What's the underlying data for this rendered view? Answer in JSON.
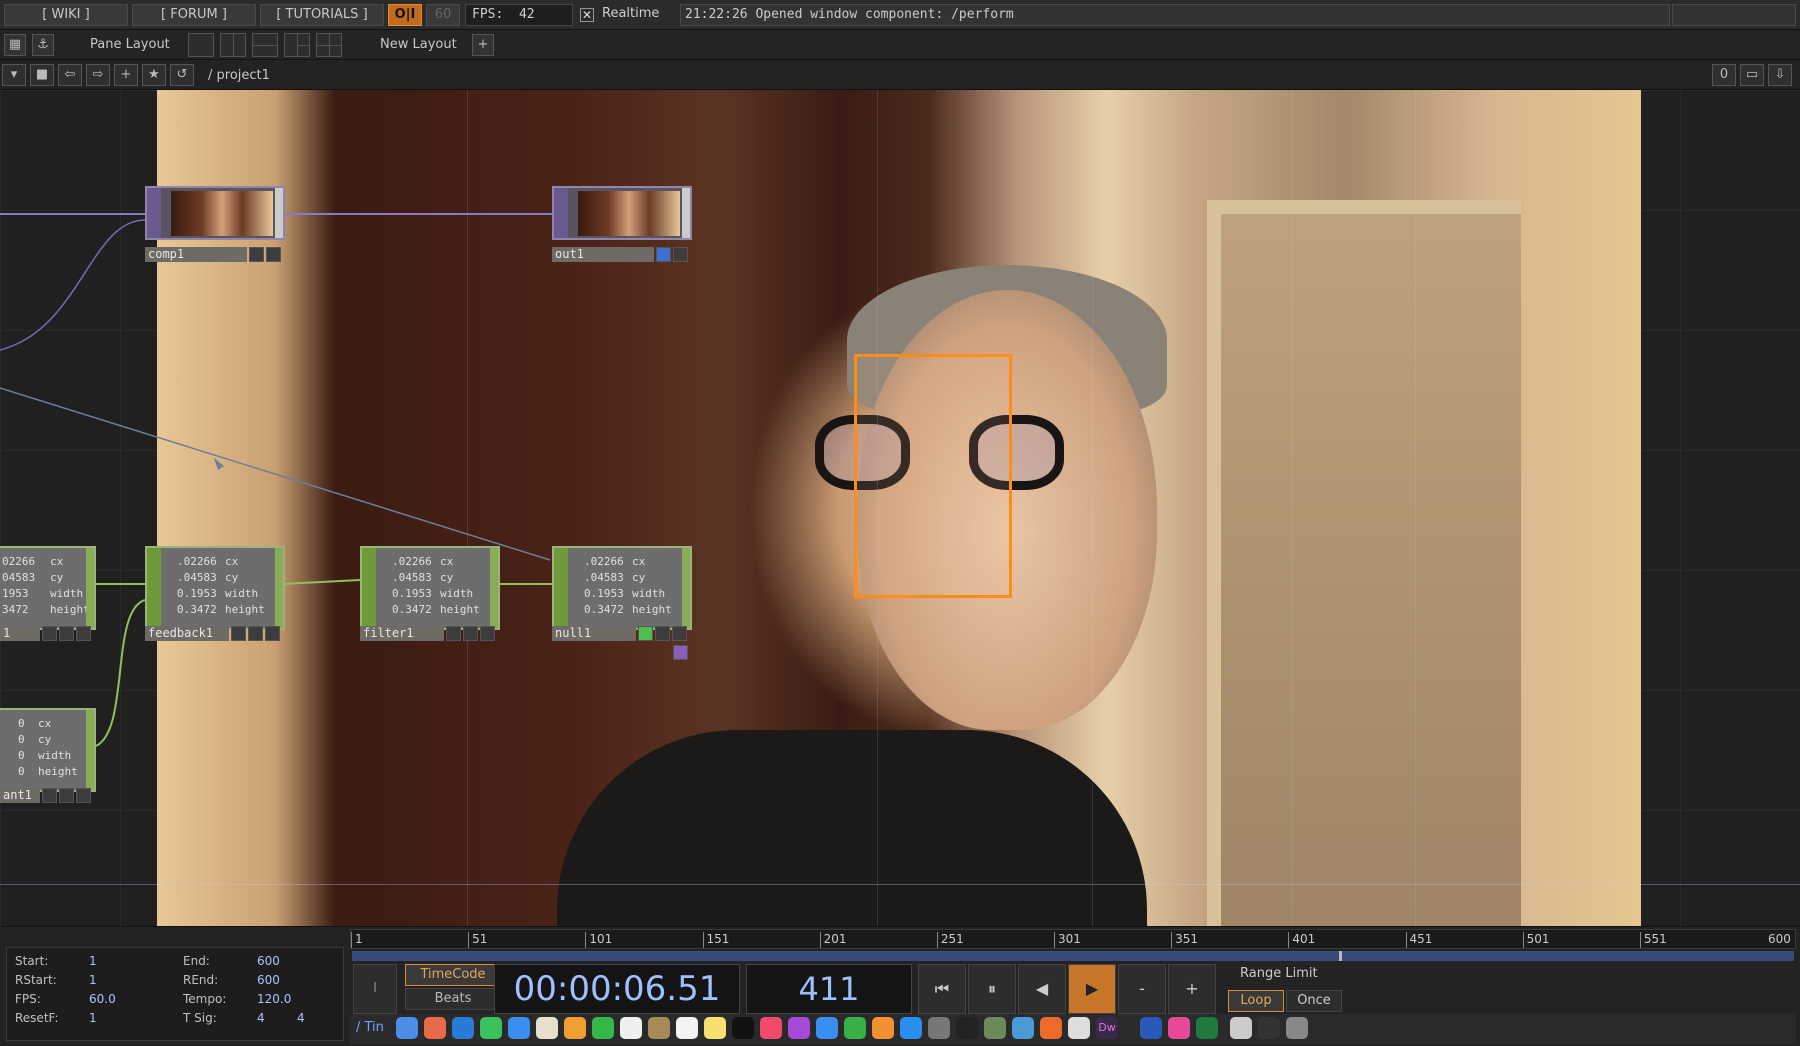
{
  "topbar": {
    "wiki": "[ WIKI ]",
    "forum": "[ FORUM ]",
    "tutorials": "[ TUTORIALS ]",
    "oi": "O|I",
    "sixty": "60",
    "fps_label": "FPS:",
    "fps_value": "42",
    "realtime_checked": "✕",
    "realtime_label": "Realtime",
    "message": "21:22:26 Opened window component: /perform"
  },
  "layoutbar": {
    "pane_layout": "Pane Layout",
    "new_layout": "New Layout",
    "add": "+"
  },
  "pathbar": {
    "path": "/ project1",
    "counter": "0"
  },
  "nodes": {
    "comp1": "comp1",
    "out1": "out1",
    "feedback1": "feedback1",
    "filter1": "filter1",
    "null1": "null1",
    "left_label1": "1",
    "constant_label": "ant1"
  },
  "chop_rows": [
    {
      "value": ".02266",
      "name": "cx"
    },
    {
      "value": ".04583",
      "name": "cy"
    },
    {
      "value": "0.1953",
      "name": "width"
    },
    {
      "value": "0.3472",
      "name": "height"
    }
  ],
  "left_chop_rows": [
    {
      "value": "02266",
      "name": "cx"
    },
    {
      "value": "04583",
      "name": "cy"
    },
    {
      "value": "1953",
      "name": "width"
    },
    {
      "value": "3472",
      "name": "height"
    }
  ],
  "const_rows": [
    {
      "value": "0",
      "name": "cx"
    },
    {
      "value": "0",
      "name": "cy"
    },
    {
      "value": "0",
      "name": "width"
    },
    {
      "value": "0",
      "name": "height"
    }
  ],
  "timeline": {
    "ticks": [
      "1",
      "51",
      "101",
      "151",
      "201",
      "251",
      "301",
      "351",
      "401",
      "451",
      "501",
      "551",
      "600"
    ],
    "current_frame_fraction": 0.6817
  },
  "info": {
    "start_label": "Start:",
    "start": "1",
    "end_label": "End:",
    "end": "600",
    "rstart_label": "RStart:",
    "rstart": "1",
    "rend_label": "REnd:",
    "rend": "600",
    "fps_label": "FPS:",
    "fps": "60.0",
    "tempo_label": "Tempo:",
    "tempo": "120.0",
    "resetf_label": "ResetF:",
    "resetf": "1",
    "tsig_label": "T Sig:",
    "tsig_a": "4",
    "tsig_b": "4"
  },
  "transport": {
    "timecode": "TimeCode",
    "beats": "Beats",
    "clock": "00:00:06.51",
    "frame": "411",
    "range_limit": "Range Limit",
    "loop": "Loop",
    "once": "Once",
    "minus": "-",
    "plus": "+",
    "tab": "Tin"
  },
  "colors": {
    "accent": "#e08a33",
    "face_box": "#ff8c1a",
    "chop_border": "#9bb47b",
    "top_border": "#8f86a8"
  }
}
